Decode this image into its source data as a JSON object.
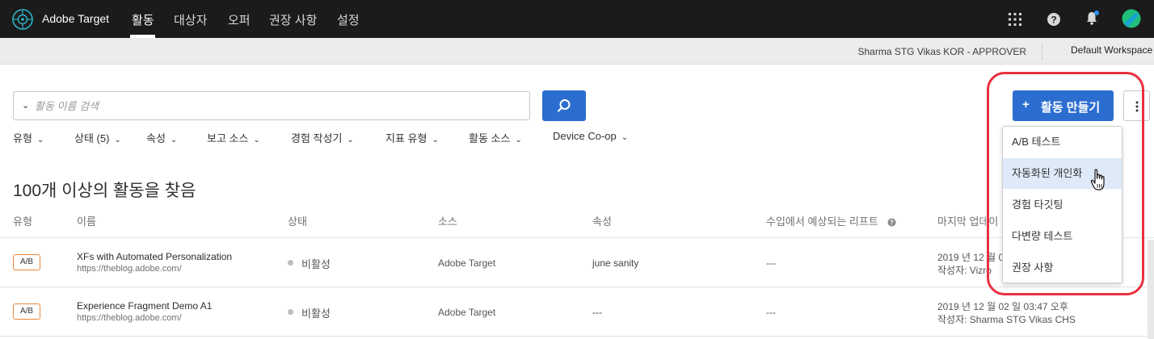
{
  "app": {
    "name": "Adobe Target"
  },
  "nav": {
    "items": [
      {
        "label": "활동",
        "active": true
      },
      {
        "label": "대상자",
        "active": false
      },
      {
        "label": "오퍼",
        "active": false
      },
      {
        "label": "권장 사항",
        "active": false
      },
      {
        "label": "설정",
        "active": false
      }
    ]
  },
  "subbar": {
    "user": "Sharma STG Vikas KOR - APPROVER",
    "workspace": "Default Workspace"
  },
  "search": {
    "placeholder": "활동 이름 검색"
  },
  "filters": [
    "유형",
    "상태 (5)",
    "속성",
    "보고 소스",
    "경험 작성기",
    "지표 유형",
    "활동 소스",
    "Device Co-op"
  ],
  "results": {
    "summary": "100개 이상의 활동을 찾음"
  },
  "table": {
    "headers": [
      "유형",
      "이름",
      "상태",
      "소스",
      "속성",
      "수입에서 예상되는 리프트",
      "마지막 업데이"
    ],
    "rows": [
      {
        "type": "A/B",
        "name": "XFs with Automated Personalization",
        "url": "https://theblog.adobe.com/",
        "status": "비활성",
        "source": "Adobe Target",
        "property": "june sanity",
        "revenue_lift": "---",
        "date": "2019 년 12 월 0",
        "author": "작성자: Vizro"
      },
      {
        "type": "A/B",
        "name": "Experience Fragment Demo A1",
        "url": "https://theblog.adobe.com/",
        "status": "비활성",
        "source": "Adobe Target",
        "property": "---",
        "revenue_lift": "---",
        "date": "2019 년 12 월 02 일 03:47 오후",
        "author": "작성자: Sharma STG Vikas CHS"
      }
    ]
  },
  "create": {
    "plus": "+",
    "label": "활동 만들기",
    "menu": [
      "A/B 테스트",
      "자동화된 개인화",
      "경험 타깃팅",
      "다변량 테스트",
      "권장 사항"
    ]
  },
  "colors": {
    "accent": "#2c6ed0",
    "highlight": "#e8303f",
    "badge_border": "#e8863a"
  },
  "icons": [
    "target-logo-icon",
    "apps-grid-icon",
    "help-icon",
    "bell-icon",
    "avatar",
    "search-icon",
    "more-vert-icon",
    "pointer-hand-icon"
  ]
}
